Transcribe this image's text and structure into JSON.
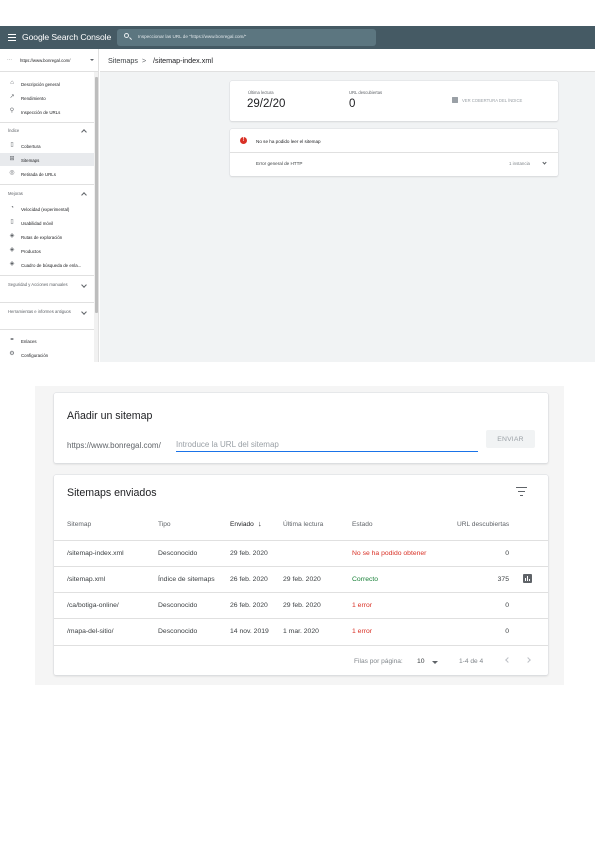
{
  "header": {
    "app_title": "Google Search Console",
    "search_placeholder": "Inspeccionar las URL de \"https://www.bonregal.com/\""
  },
  "sidebar": {
    "property": "https://www.bonregal.com/",
    "items_top": [
      {
        "label": "Descripción general",
        "icon": "home-icon"
      },
      {
        "label": "Rendimiento",
        "icon": "trending-up-icon"
      },
      {
        "label": "Inspección de URLs",
        "icon": "search-icon"
      }
    ],
    "section_index": "Índice",
    "items_index": [
      {
        "label": "Cobertura",
        "icon": "file-icon"
      },
      {
        "label": "Sitemaps",
        "icon": "sitemap-icon"
      },
      {
        "label": "Retirada de URLs",
        "icon": "eye-off-icon"
      }
    ],
    "section_improvements": "Mejoras",
    "items_improvements": [
      {
        "label": "Velocidad (experimental)",
        "icon": "speed-icon"
      },
      {
        "label": "Usabilidad móvil",
        "icon": "phone-icon"
      },
      {
        "label": "Rutas de exploración",
        "icon": "layers-icon"
      },
      {
        "label": "Productos",
        "icon": "layers-icon"
      },
      {
        "label": "Cuadro de búsqueda de enla...",
        "icon": "layers-icon"
      }
    ],
    "section_security": "Seguridad y Acciones manuales",
    "section_legacy": "Herramientas e informes antiguos",
    "items_bottom": [
      {
        "label": "Enlaces",
        "icon": "links-icon"
      },
      {
        "label": "Configuración",
        "icon": "settings-icon"
      }
    ]
  },
  "breadcrumb": {
    "parent": "Sitemaps",
    "separator": ">",
    "current": "/sitemap-index.xml"
  },
  "sitemap_detail": {
    "last_read_label": "Última lectura",
    "last_read_value": "29/2/20",
    "discovered_label": "URL descubiertas",
    "discovered_value": "0",
    "coverage_link": "VER COBERTURA DEL ÍNDICE",
    "error_icon": "!",
    "error_message": "No se ha podido leer el sitemap",
    "error_type": "Error general de HTTP",
    "error_instances": "1 instancia"
  },
  "add_sitemap": {
    "title": "Añadir un sitemap",
    "url_prefix": "https://www.bonregal.com/",
    "placeholder": "Introduce la URL del sitemap",
    "submit_label": "ENVIAR"
  },
  "sent_sitemaps": {
    "title": "Sitemaps enviados",
    "columns": [
      "Sitemap",
      "Tipo",
      "Enviado",
      "Última lectura",
      "Estado",
      "URL descubiertas"
    ],
    "sort_icon": "↓",
    "rows": [
      {
        "sitemap": "/sitemap-index.xml",
        "type": "Desconocido",
        "sent": "29 feb. 2020",
        "last_read": "",
        "status": "No se ha podido obtener",
        "status_kind": "error",
        "discovered": "0",
        "has_chart": false
      },
      {
        "sitemap": "/sitemap.xml",
        "type": "Índice de sitemaps",
        "sent": "26 feb. 2020",
        "last_read": "29 feb. 2020",
        "status": "Correcto",
        "status_kind": "ok",
        "discovered": "375",
        "has_chart": true
      },
      {
        "sitemap": "/ca/botiga-online/",
        "type": "Desconocido",
        "sent": "26 feb. 2020",
        "last_read": "29 feb. 2020",
        "status": "1 error",
        "status_kind": "error",
        "discovered": "0",
        "has_chart": false
      },
      {
        "sitemap": "/mapa-del-sitio/",
        "type": "Desconocido",
        "sent": "14 nov. 2019",
        "last_read": "1 mar. 2020",
        "status": "1 error",
        "status_kind": "error",
        "discovered": "0",
        "has_chart": false
      }
    ],
    "footer": {
      "rows_per_page_label": "Filas por página:",
      "rows_per_page_value": "10",
      "range": "1-4 de 4"
    }
  },
  "colors": {
    "topbar": "#455a64",
    "error": "#d93025",
    "success": "#188038",
    "link_blue": "#1a73e8"
  }
}
